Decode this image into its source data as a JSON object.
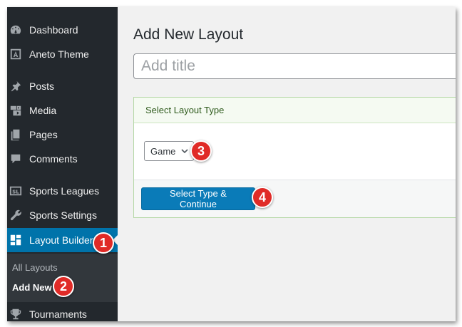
{
  "sidebar": {
    "items": [
      {
        "label": "Dashboard",
        "icon": "dashboard-icon"
      },
      {
        "label": "Aneto Theme",
        "icon": "letter-a-icon"
      },
      {
        "label": "Posts",
        "icon": "pushpin-icon"
      },
      {
        "label": "Media",
        "icon": "media-icon"
      },
      {
        "label": "Pages",
        "icon": "pages-icon"
      },
      {
        "label": "Comments",
        "icon": "comment-icon"
      },
      {
        "label": "Sports Leagues",
        "icon": "sl-badge-icon"
      },
      {
        "label": "Sports Settings",
        "icon": "wrench-icon"
      },
      {
        "label": "Layout Builder",
        "icon": "layout-grid-icon",
        "active": true
      },
      {
        "label": "Tournaments",
        "icon": "trophy-icon"
      }
    ],
    "submenu": [
      {
        "label": "All Layouts"
      },
      {
        "label": "Add New",
        "current": true
      }
    ]
  },
  "main": {
    "page_title": "Add New Layout",
    "title_placeholder": "Add title",
    "panel_heading": "Select Layout Type",
    "select_value": "Game",
    "continue_label": "Select Type & Continue"
  },
  "badges": [
    "1",
    "2",
    "3",
    "4"
  ],
  "colors": {
    "sidebar_bg": "#23282d",
    "active_bg": "#0073aa",
    "primary_button": "#0a7bb8",
    "badge": "#e02b27"
  }
}
